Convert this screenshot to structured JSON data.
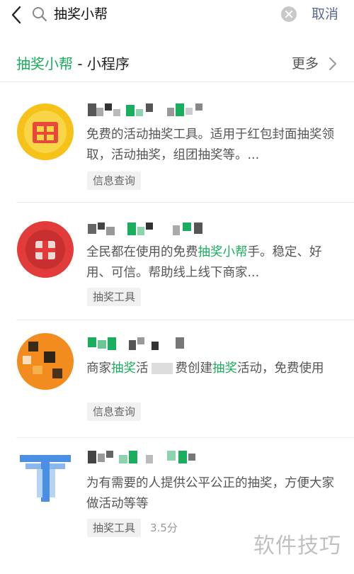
{
  "search": {
    "query": "抽奖小帮",
    "cancel_label": "取消"
  },
  "section": {
    "title_highlight": "抽奖小帮",
    "title_suffix": " - 小程序",
    "more_label": "更多"
  },
  "results": [
    {
      "desc": "免费的活动抽奖工具。适用于红包封面抽奖领取，活动抽奖，组团抽奖等。...",
      "tag": "信息查询"
    },
    {
      "desc_pre": "全民都在使用的免费",
      "desc_hl": "抽奖小帮",
      "desc_post": "手。稳定、好用、可信。帮助线上线下商家...",
      "tag": "抽奖工具"
    },
    {
      "desc_a": "商家",
      "desc_b": "抽奖",
      "desc_c": "活",
      "desc_d": "费创建",
      "desc_e": "抽奖",
      "desc_f": "活动，免费使用",
      "tag": "信息查询"
    },
    {
      "desc": "为有需要的人提供公平公正的抽奖，方便大家做活动等等",
      "tag": "抽奖工具",
      "rating": "3.5分"
    }
  ],
  "watermark": "软件技巧",
  "colors": {
    "accent_green": "#1aad5d",
    "link_blue": "#5a6b8d",
    "divider": "#ececec"
  }
}
